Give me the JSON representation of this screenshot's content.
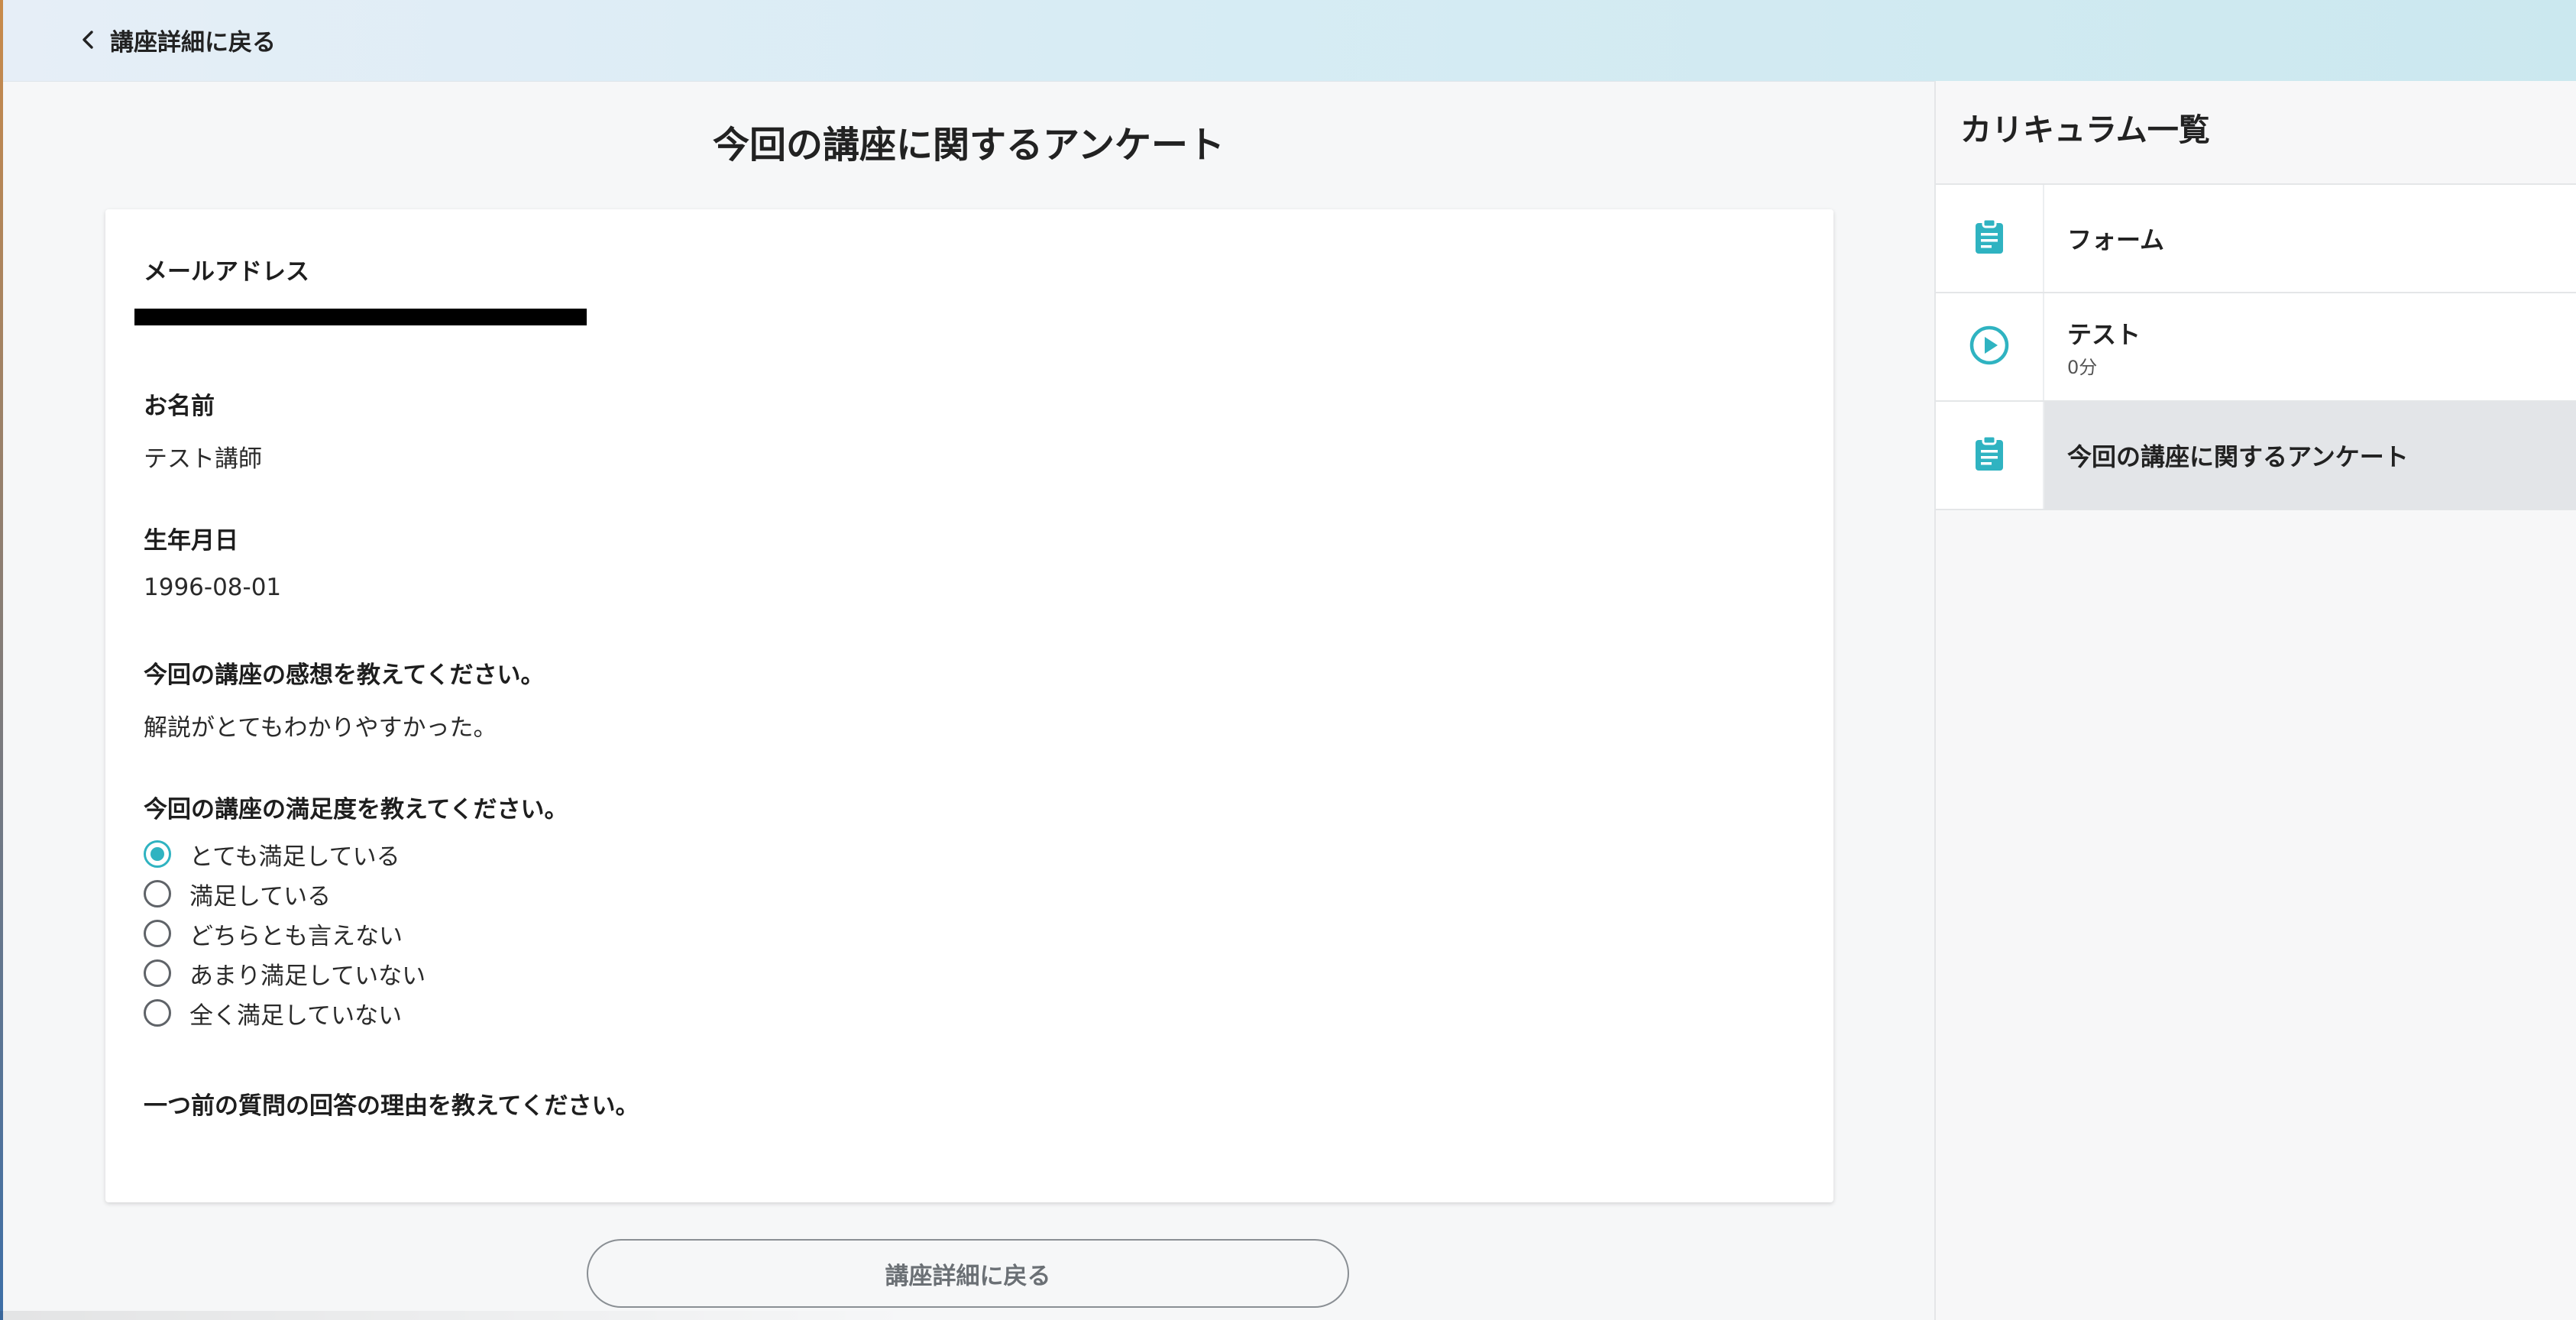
{
  "header": {
    "back_label": "講座詳細に戻る"
  },
  "main": {
    "page_title": "今回の講座に関するアンケート",
    "fields": [
      {
        "label": "メールアドレス",
        "value": ""
      },
      {
        "label": "お名前",
        "value": "テスト講師"
      },
      {
        "label": "生年月日",
        "value": "1996-08-01"
      },
      {
        "label": "今回の講座の感想を教えてください。",
        "value": "解説がとてもわかりやすかった。"
      }
    ],
    "satisfaction": {
      "label": "今回の講座の満足度を教えてください。",
      "options": [
        "とても満足している",
        "満足している",
        "どちらとも言えない",
        "あまり満足していない",
        "全く満足していない"
      ],
      "selected_index": 0
    },
    "reason_label": "一つ前の質問の回答の理由を教えてください。",
    "bottom_button_label": "講座詳細に戻る"
  },
  "sidebar": {
    "title": "カリキュラム一覧",
    "items": [
      {
        "title": "フォーム",
        "subtitle": "",
        "icon": "clipboard-icon"
      },
      {
        "title": "テスト",
        "subtitle": "0分",
        "icon": "play-circle-icon"
      },
      {
        "title": "今回の講座に関するアンケート",
        "subtitle": "",
        "icon": "clipboard-icon"
      }
    ],
    "active_index": 2
  },
  "colors": {
    "accent": "#2fb3c1",
    "active_row": "#e3e5e8"
  }
}
